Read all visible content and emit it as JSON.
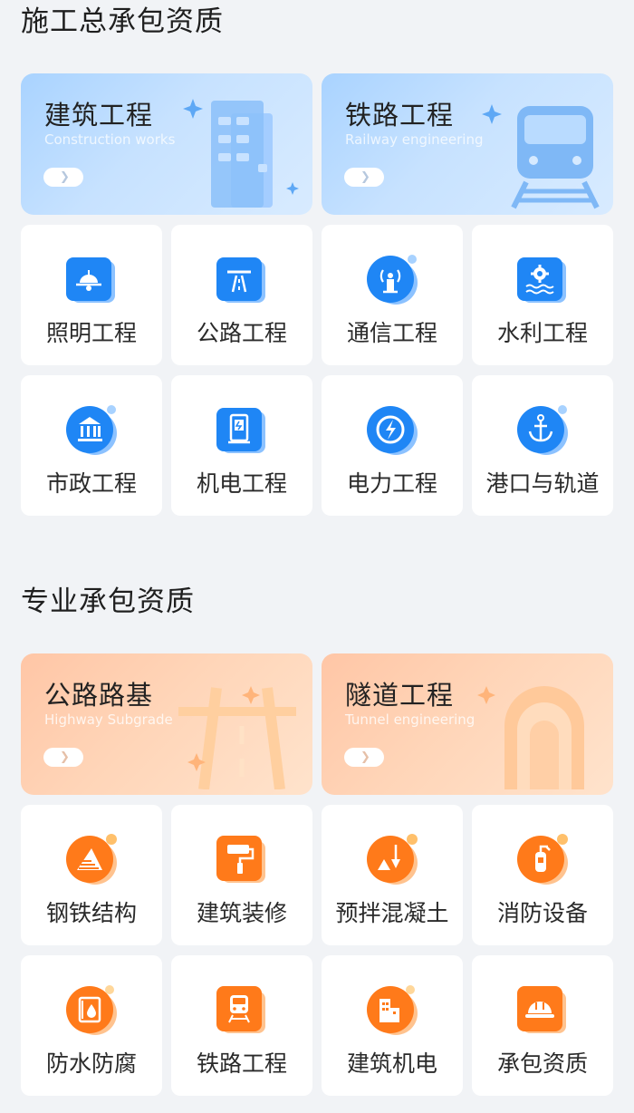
{
  "sections": {
    "general": {
      "title": "施工总承包资质",
      "banners": [
        {
          "title": "建筑工程",
          "subtitle": "Construction works",
          "icon": "building-icon"
        },
        {
          "title": "铁路工程",
          "subtitle": "Railway engineering",
          "icon": "train-icon"
        }
      ],
      "items": [
        {
          "label": "照明工程",
          "icon": "lamp-icon"
        },
        {
          "label": "公路工程",
          "icon": "highway-icon"
        },
        {
          "label": "通信工程",
          "icon": "signal-tower-icon"
        },
        {
          "label": "水利工程",
          "icon": "water-gear-icon"
        },
        {
          "label": "市政工程",
          "icon": "municipal-building-icon"
        },
        {
          "label": "机电工程",
          "icon": "electromechanical-icon"
        },
        {
          "label": "电力工程",
          "icon": "power-bolt-icon"
        },
        {
          "label": "港口与轨道",
          "icon": "anchor-icon"
        }
      ]
    },
    "pro": {
      "title": "专业承包资质",
      "banners": [
        {
          "title": "公路路基",
          "subtitle": "Highway Subgrade",
          "icon": "road-icon"
        },
        {
          "title": "隧道工程",
          "subtitle": "Tunnel engineering",
          "icon": "tunnel-icon"
        }
      ],
      "items": [
        {
          "label": "钢铁结构",
          "icon": "steel-structure-icon"
        },
        {
          "label": "建筑装修",
          "icon": "paint-roller-icon"
        },
        {
          "label": "预拌混凝土",
          "icon": "concrete-shovel-icon"
        },
        {
          "label": "消防设备",
          "icon": "fire-extinguisher-icon"
        },
        {
          "label": "防水防腐",
          "icon": "waterproof-icon"
        },
        {
          "label": "铁路工程",
          "icon": "railway-icon"
        },
        {
          "label": "建筑机电",
          "icon": "building-electric-icon"
        },
        {
          "label": "承包资质",
          "icon": "hard-hat-icon"
        }
      ]
    }
  },
  "colors": {
    "blue_accent": "#1f86f5",
    "orange_accent": "#ff7a1a",
    "background": "#f1f3f6"
  }
}
